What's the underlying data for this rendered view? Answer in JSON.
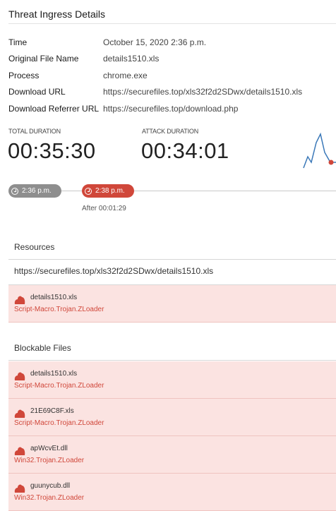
{
  "panel_title": "Threat Ingress Details",
  "details": [
    {
      "label": "Time",
      "value": "October 15, 2020 2:36 p.m."
    },
    {
      "label": "Original File Name",
      "value": "details1510.xls"
    },
    {
      "label": "Process",
      "value": "chrome.exe"
    },
    {
      "label": "Download URL",
      "value": "https://securefiles.top/xls32f2d2SDwx/details1510.xls"
    },
    {
      "label": "Download Referrer URL",
      "value": "https://securefiles.top/download.php"
    }
  ],
  "durations": {
    "total_label": "TOTAL DURATION",
    "total_value": "00:35:30",
    "attack_label": "ATTACK DURATION",
    "attack_value": "00:34:01"
  },
  "timeline": {
    "start_time": "2:36 p.m.",
    "event_time": "2:38 p.m.",
    "after_label": "After 00:01:29"
  },
  "resources": {
    "heading": "Resources",
    "url": "https://securefiles.top/xls32f2d2SDwx/details1510.xls",
    "items": [
      {
        "file": "details1510.xls",
        "threat": "Script-Macro.Trojan.ZLoader"
      }
    ]
  },
  "blockable": {
    "heading": "Blockable Files",
    "items": [
      {
        "file": "details1510.xls",
        "threat": "Script-Macro.Trojan.ZLoader"
      },
      {
        "file": "21E69C8F.xls",
        "threat": "Script-Macro.Trojan.ZLoader"
      },
      {
        "file": "apWcvEt.dll",
        "threat": "Win32.Trojan.ZLoader"
      },
      {
        "file": "guunycub.dll",
        "threat": "Win32.Trojan.ZLoader"
      }
    ]
  },
  "colors": {
    "threat_red": "#d0473a",
    "threat_bg": "#fbe3e1",
    "pill_grey": "#8e8e8e"
  },
  "icons": {
    "file_threat": "threat-blob-icon",
    "clock": "clock-icon",
    "sparkline": "activity-sparkline-icon"
  }
}
